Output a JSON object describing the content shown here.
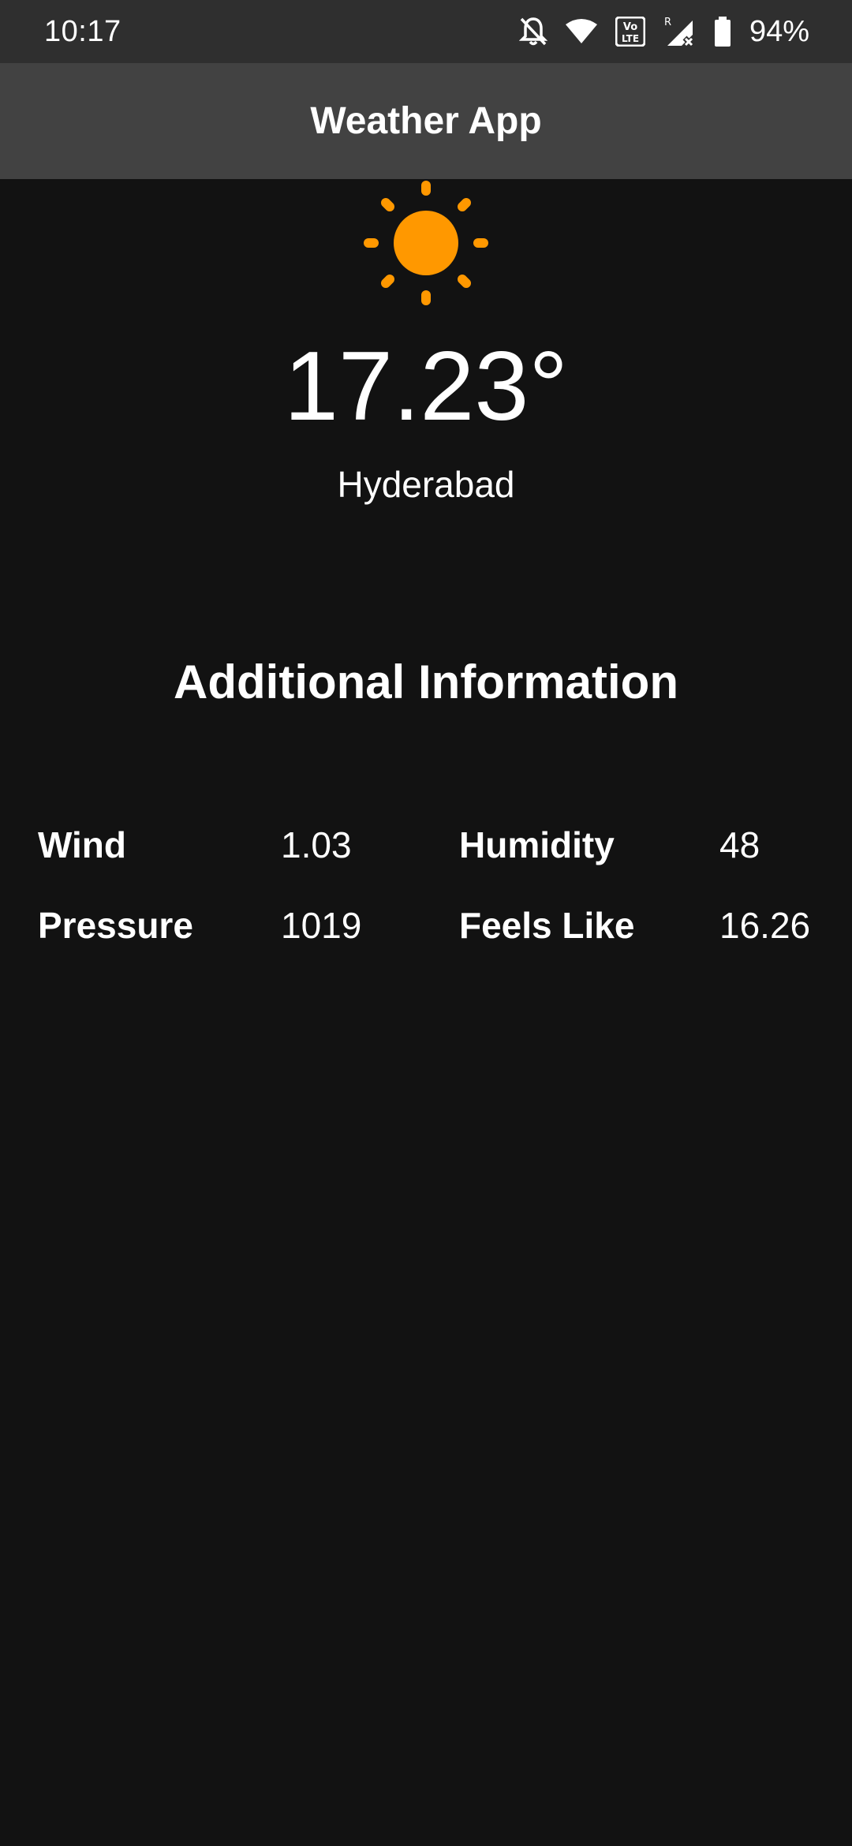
{
  "status_bar": {
    "time": "10:17",
    "battery_percent": "94%",
    "icons": [
      "notifications-off-icon",
      "wifi-icon",
      "volte-icon",
      "roaming-signal-icon",
      "battery-icon"
    ]
  },
  "app_bar": {
    "title": "Weather App"
  },
  "weather": {
    "icon": "sun-icon",
    "icon_color": "#FF9800",
    "temperature": "17.23°",
    "city": "Hyderabad"
  },
  "additional_info": {
    "title": "Additional Information",
    "items": [
      {
        "label": "Wind",
        "value": "1.03"
      },
      {
        "label": "Humidity",
        "value": "48"
      },
      {
        "label": "Pressure",
        "value": "1019"
      },
      {
        "label": "Feels Like",
        "value": "16.26"
      }
    ]
  },
  "colors": {
    "background": "#121212",
    "status_bar": "#2F2F2F",
    "app_bar": "#424242",
    "text": "#FFFFFF",
    "accent": "#FF9800"
  }
}
